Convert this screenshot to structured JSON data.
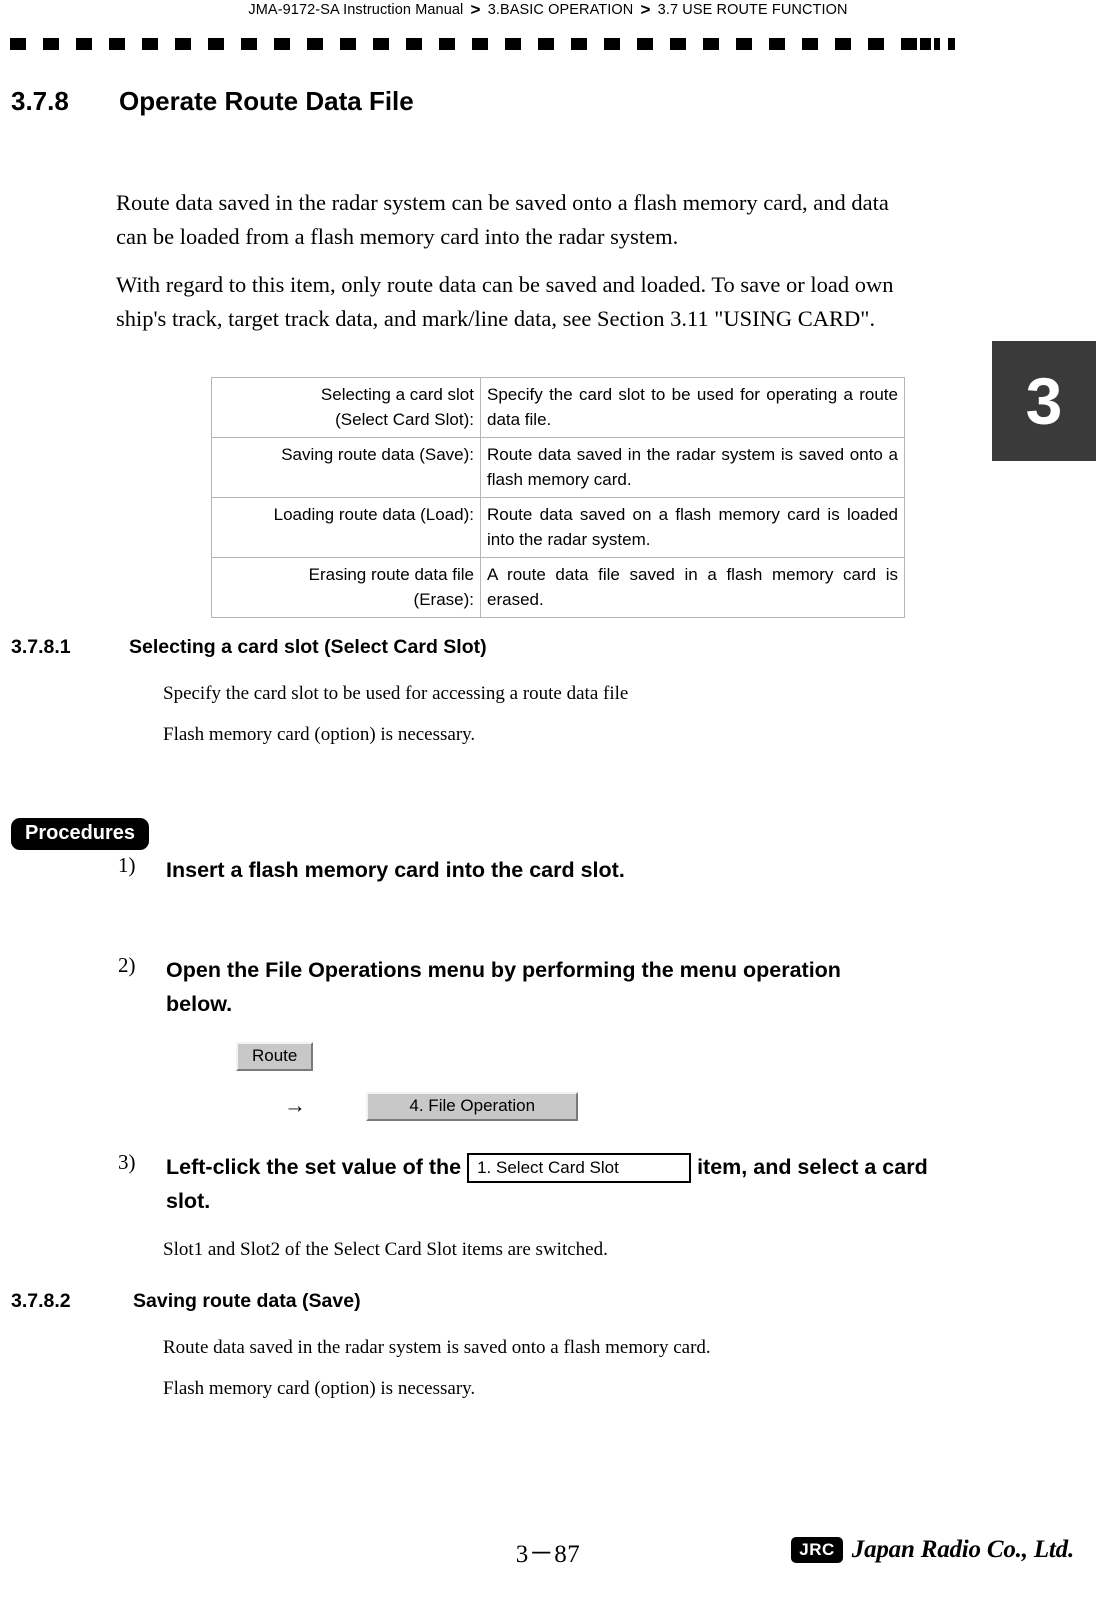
{
  "header": {
    "manual": "JMA-9172-SA Instruction Manual",
    "separator": ">",
    "chapter": "3.BASIC OPERATION",
    "section": "3.7  USE ROUTE FUNCTION"
  },
  "chapter_tab": {
    "number": "3"
  },
  "section": {
    "number": "3.7.8",
    "title": "Operate Route Data File"
  },
  "intro": {
    "paragraph1": "Route data saved in the radar system can be saved onto a flash memory card, and data can be loaded from a flash memory card into the radar system.",
    "paragraph2": "With regard to this item, only route data can be saved and loaded. To save or load own ship's track, target track data, and mark/line data, see Section 3.11 \"USING CARD\"."
  },
  "definition_table": {
    "rows": [
      {
        "term_line1": "Selecting a card slot",
        "term_line2": "(Select Card Slot):",
        "description": "Specify the card slot to be used for operating a route data file."
      },
      {
        "term_line1": "Saving route data (Save):",
        "term_line2": "",
        "description": "Route data saved in the radar system is saved onto a flash memory card."
      },
      {
        "term_line1": "Loading route data (Load):",
        "term_line2": "",
        "description": "Route data saved on a flash memory card is loaded into the radar system."
      },
      {
        "term_line1": "Erasing route data file",
        "term_line2": "(Erase):",
        "description": "A route data file saved in a flash memory card is erased."
      }
    ]
  },
  "subsection_1": {
    "number": "3.7.8.1",
    "title": "Selecting a card slot (Select Card Slot)",
    "line1": "Specify the card slot to be used for accessing a route data file",
    "line2": "Flash memory card (option) is necessary."
  },
  "procedures": {
    "badge": "Procedures",
    "steps": [
      {
        "marker": "1)",
        "text": "Insert a flash memory card into the card slot."
      },
      {
        "marker": "2)",
        "text": "Open the File Operations menu by performing the menu operation below."
      },
      {
        "marker": "3)",
        "text_before": "Left-click the set value of the",
        "text_after": "item, and select a card slot.",
        "field_value": "1. Select Card Slot"
      }
    ],
    "menu_path": {
      "button1": "Route",
      "arrow": "→",
      "button2": "4. File Operation"
    },
    "note": "Slot1 and Slot2 of the Select Card Slot items are switched."
  },
  "subsection_2": {
    "number": "3.7.8.2",
    "title": "Saving route data (Save)",
    "line1": "Route data saved in the radar system is saved onto a flash memory card.",
    "line2": "Flash memory card (option) is necessary."
  },
  "footer": {
    "folio": "3－87",
    "logo_mark": "JRC",
    "logo_word": "Japan Radio Co., Ltd."
  }
}
